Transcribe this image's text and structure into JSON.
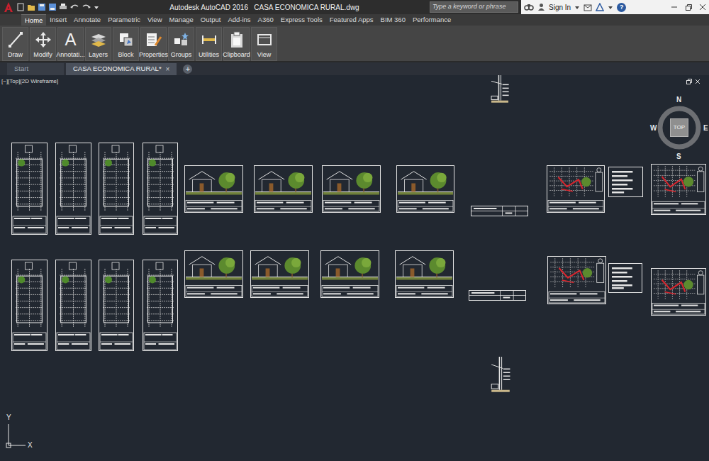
{
  "window": {
    "title": "Autodesk AutoCAD 2016   CASA ECONOMICA RURAL.dwg"
  },
  "search": {
    "placeholder": "Type a keyword or phrase"
  },
  "account": {
    "label": "Sign In"
  },
  "help": "?",
  "ribbon_tabs": [
    {
      "label": "Home",
      "selected": true
    },
    {
      "label": "Insert",
      "selected": false
    },
    {
      "label": "Annotate",
      "selected": false
    },
    {
      "label": "Parametric",
      "selected": false
    },
    {
      "label": "View",
      "selected": false
    },
    {
      "label": "Manage",
      "selected": false
    },
    {
      "label": "Output",
      "selected": false
    },
    {
      "label": "Add-ins",
      "selected": false
    },
    {
      "label": "A360",
      "selected": false
    },
    {
      "label": "Express Tools",
      "selected": false
    },
    {
      "label": "Featured Apps",
      "selected": false
    },
    {
      "label": "BIM 360",
      "selected": false
    },
    {
      "label": "Performance",
      "selected": false
    }
  ],
  "ribbon_panels": [
    {
      "label": "Draw"
    },
    {
      "label": "Modify"
    },
    {
      "label": "Annotati...",
      "icon": "A"
    },
    {
      "label": "Layers"
    },
    {
      "label": "Block"
    },
    {
      "label": "Properties"
    },
    {
      "label": "Groups"
    },
    {
      "label": "Utilities"
    },
    {
      "label": "Clipboard"
    },
    {
      "label": "View"
    }
  ],
  "file_tabs": [
    {
      "label": "Start",
      "selected": false
    },
    {
      "label": "CASA ECONOMICA RURAL*",
      "selected": true,
      "close": "×"
    }
  ],
  "new_tab": "+",
  "viewport": {
    "label": "[−][Top][2D Wireframe]"
  },
  "viewcube": {
    "face": "TOP",
    "north": "N",
    "south": "S",
    "east": "E",
    "west": "W"
  },
  "ucs": {
    "x": "X",
    "y": "Y"
  },
  "sheets": [
    {
      "kind": "plan"
    },
    {
      "kind": "plan"
    },
    {
      "kind": "plan"
    },
    {
      "kind": "plan"
    },
    {
      "kind": "elevation"
    },
    {
      "kind": "elevation"
    },
    {
      "kind": "elevation"
    },
    {
      "kind": "elevation"
    },
    {
      "kind": "strip"
    },
    {
      "kind": "site"
    },
    {
      "kind": "legend"
    },
    {
      "kind": "site"
    },
    {
      "kind": "plan"
    },
    {
      "kind": "plan"
    },
    {
      "kind": "plan"
    },
    {
      "kind": "plan"
    },
    {
      "kind": "elevation"
    },
    {
      "kind": "elevation"
    },
    {
      "kind": "elevation"
    },
    {
      "kind": "elevation"
    },
    {
      "kind": "strip"
    },
    {
      "kind": "site"
    },
    {
      "kind": "legend"
    },
    {
      "kind": "site"
    },
    {
      "kind": "detail"
    },
    {
      "kind": "detail"
    }
  ]
}
